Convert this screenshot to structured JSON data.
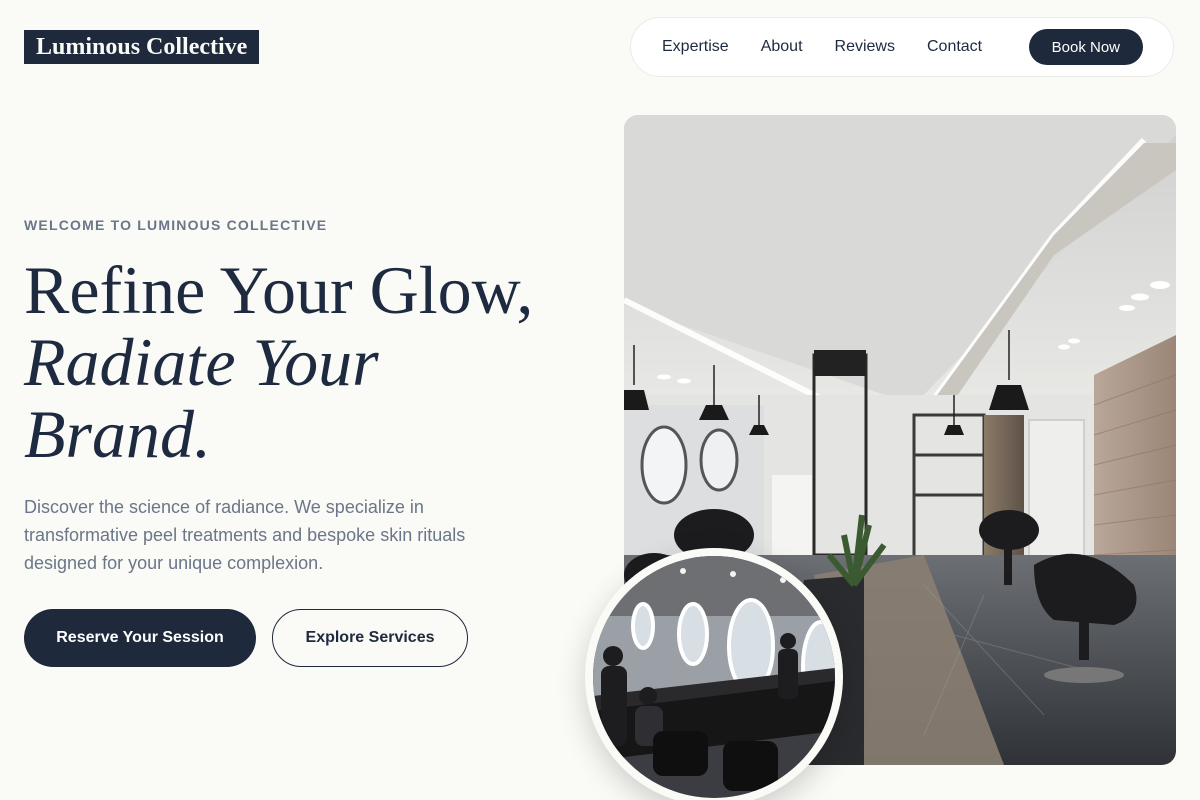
{
  "brand": {
    "name": "Luminous Collective"
  },
  "nav": {
    "items": [
      "Expertise",
      "About",
      "Reviews",
      "Contact"
    ],
    "cta_label": "Book Now"
  },
  "hero": {
    "eyebrow": "WELCOME TO LUMINOUS COLLECTIVE",
    "headline_line1": "Refine Your Glow,",
    "headline_line2": "Radiate Your",
    "headline_line3": "Brand.",
    "description": "Discover the science of radiance. We specialize in transformative peel treatments and bespoke skin rituals designed for your unique complexion.",
    "primary_cta": "Reserve Your Session",
    "secondary_cta": "Explore Services"
  },
  "colors": {
    "background": "#fafaf7",
    "ink": "#1e293b",
    "muted": "#6b7688"
  },
  "images": {
    "main": "salon-interior-photo",
    "inset": "salon-mirrors-photo"
  }
}
